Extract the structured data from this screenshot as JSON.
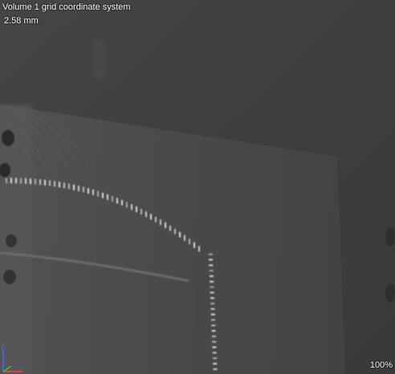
{
  "viewer": {
    "title": "Volume 1 grid coordinate system",
    "scale": "2.58 mm",
    "zoom": "100%"
  },
  "axes": {
    "z_label": "z",
    "z_color": "#4a6cff",
    "x_color": "#ff4040",
    "y_color": "#40c040"
  },
  "colors": {
    "background": "#3f3f3f",
    "overlay_text": "#ffffff"
  }
}
